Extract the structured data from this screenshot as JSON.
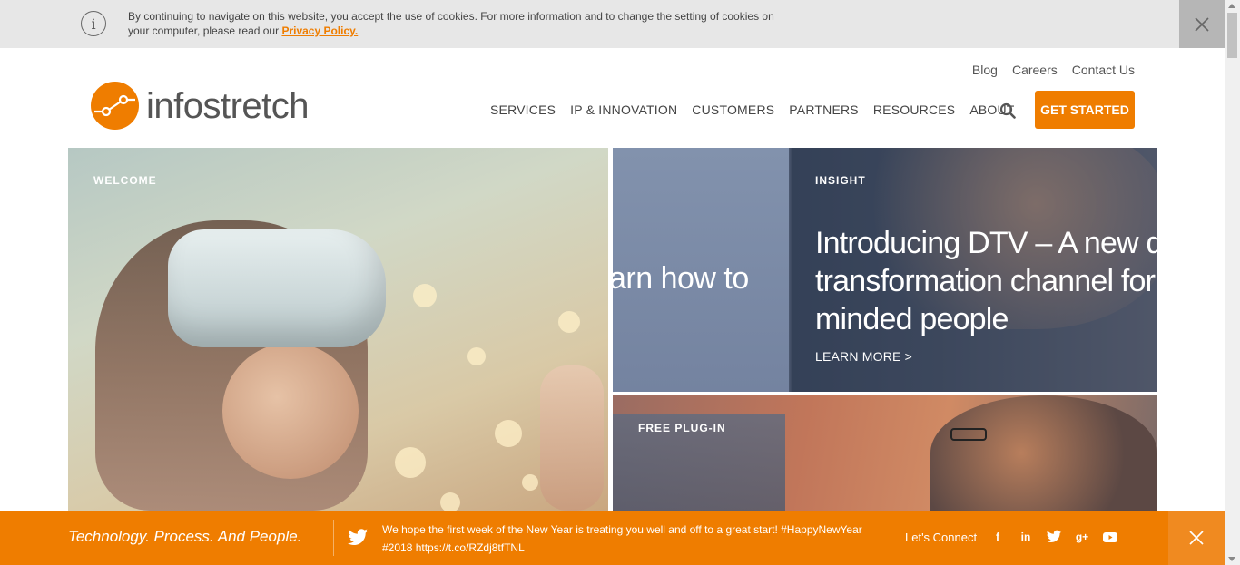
{
  "cookie_bar": {
    "text": "By continuing to navigate on this website, you accept the use of cookies. For more information and to change the setting of cookies on your computer, please read our ",
    "link": "Privacy Policy.",
    "info_icon": "info-icon",
    "close_icon": "close-icon"
  },
  "header": {
    "logo_text": "infostretch",
    "util_nav": [
      "Blog",
      "Careers",
      "Contact Us"
    ],
    "main_nav": [
      "SERVICES",
      "IP & INNOVATION",
      "CUSTOMERS",
      "PARTNERS",
      "RESOURCES",
      "ABOUT"
    ],
    "cta": "GET STARTED",
    "accent_color": "#ef7d00"
  },
  "tiles": {
    "welcome": {
      "label": "WELCOME"
    },
    "insight": {
      "label": "INSIGHT",
      "peek_text": "arn how to",
      "headline_lines": [
        "Introducing DTV – A new d",
        "transformation channel for",
        "minded people"
      ],
      "learn_more": "LEARN MORE >"
    },
    "plugin": {
      "label": "FREE PLUG-IN"
    }
  },
  "footer": {
    "tagline": "Technology. Process. And People.",
    "tweet": "We hope the first week of the New Year is treating you well and off to a great start! #HappyNewYear #2018 https://t.co/RZdj8tfTNL",
    "lets_connect": "Let's Connect",
    "social": [
      "f",
      "in",
      "twitter",
      "g+",
      "youtube"
    ]
  }
}
